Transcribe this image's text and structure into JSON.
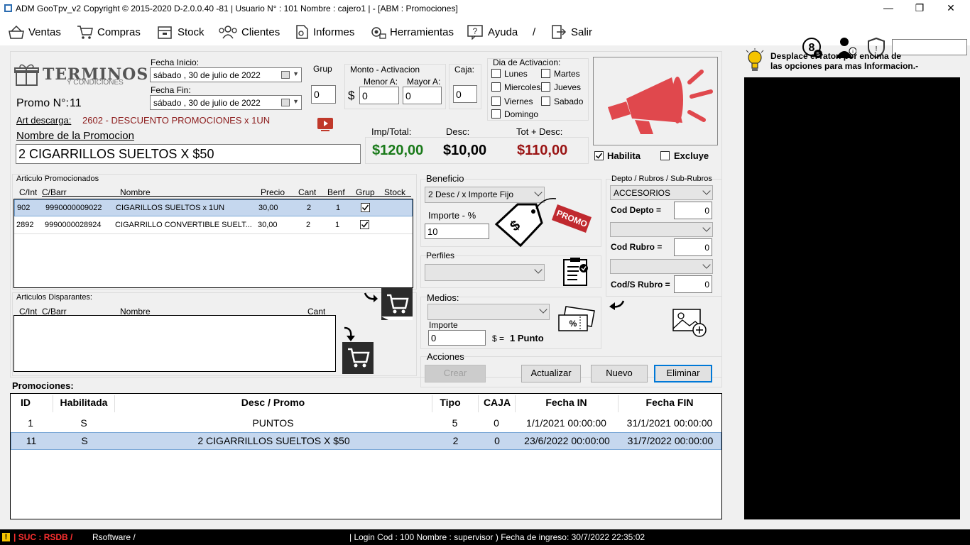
{
  "window": {
    "title": "ADM GooTpv_v2 Copyright ©  2015-2020 D-2.0.0.40 -81 | Usuario N° : 101 Nombre : cajero1 | - [ABM : Promociones]",
    "minimize": "—",
    "maximize": "❐",
    "close": "✕"
  },
  "menu": {
    "ventas": "Ventas",
    "compras": "Compras",
    "stock": "Stock",
    "clientes": "Clientes",
    "informes": "Informes",
    "herramientas": "Herramientas",
    "ayuda": "Ayuda",
    "separator": "/",
    "salir": "Salir"
  },
  "header_icons": [
    "numeric-badge-icon",
    "user-info-icon",
    "shield-icon"
  ],
  "logo": {
    "line1": "TERMINOS",
    "line2": "Y CONDICIONES"
  },
  "promo": {
    "number_label": "Promo N°:",
    "number": "11",
    "fecha_inicio_label": "Fecha Inicio:",
    "fecha_inicio": "sábado  , 30 de      julio      de 2022",
    "fecha_fin_label": "Fecha Fin:",
    "fecha_fin": "sábado  , 30 de      julio      de 2022",
    "grup_label": "Grup",
    "grup": "0",
    "monto_label": "Monto - Activacion",
    "menor_label": "Menor A:",
    "mayor_label": "Mayor A:",
    "currency": "$",
    "menor": "0",
    "mayor": "0",
    "caja_label": "Caja:",
    "caja": "0",
    "art_descarga_label": "Art descarga:",
    "art_descarga": "2602 - DESCUENTO PROMOCIONES  x 1UN",
    "nombre_label": "Nombre de la Promocion",
    "nombre": "2 CIGARRILLOS SUELTOS X $50"
  },
  "dias": {
    "label": "Dia de Activacion:",
    "lunes": "Lunes",
    "martes": "Martes",
    "miercoles": "Miercoles",
    "jueves": "Jueves",
    "viernes": "Viernes",
    "sabado": "Sabado",
    "domingo": "Domingo"
  },
  "totals": {
    "imp_label": "Imp/Total:",
    "desc_label": "Desc:",
    "tot_label": "Tot + Desc:",
    "imp": "$120,00",
    "desc": "$10,00",
    "tot": "$110,00",
    "colors": {
      "imp": "#1a7a1a",
      "desc": "#000000",
      "tot": "#9a1414"
    }
  },
  "flags": {
    "habilita_label": "Habilita",
    "habilita": true,
    "excluye_label": "Excluye",
    "excluye": false
  },
  "promocionados": {
    "label": "Articulo Promocionados",
    "columns": [
      "C/Int",
      "C/Barr",
      "Nombre",
      "Precio",
      "Cant",
      "Benf",
      "Grup",
      "Stock"
    ],
    "rows": [
      {
        "cint": "902",
        "cbarr": "9990000009022",
        "nombre": "CIGARILLOS SUELTOS  x 1UN",
        "precio": "30,00",
        "cant": "2",
        "benf": "1",
        "grup": true
      },
      {
        "cint": "2892",
        "cbarr": "9990000028924",
        "nombre": "CIGARRILLO CONVERTIBLE SUELT...",
        "precio": "30,00",
        "cant": "2",
        "benf": "1",
        "grup": true
      }
    ]
  },
  "disparantes": {
    "label": "Articulos Disparantes:",
    "columns": [
      "C/Int",
      "C/Barr",
      "Nombre",
      "Cant"
    ]
  },
  "beneficio": {
    "label": "Beneficio",
    "tipo": "2 Desc / x Importe Fijo",
    "importe_label": "Importe - %",
    "importe": "10"
  },
  "perfiles": {
    "label": "Perfiles",
    "value": ""
  },
  "medios": {
    "label": "Medios:",
    "value": "",
    "importe_label": "Importe",
    "importe": "0",
    "equals": "$ =",
    "punto": "1 Punto"
  },
  "depto": {
    "label": "Depto / Rubros / Sub-Rubros",
    "depto_value": "ACCESORIOS",
    "cod_depto_label": "Cod Depto =",
    "cod_depto": "0",
    "rubro_value": "",
    "cod_rubro_label": "Cod Rubro =",
    "cod_rubro": "0",
    "srubro_value": "",
    "cod_srubro_label": "Cod/S Rubro =",
    "cod_srubro": "0"
  },
  "acciones": {
    "label": "Acciones",
    "crear": "Crear",
    "actualizar": "Actualizar",
    "nuevo": "Nuevo",
    "eliminar": "Eliminar"
  },
  "promociones": {
    "label": "Promociones:",
    "columns": [
      "ID",
      "Habilitada",
      "Desc / Promo",
      "Tipo",
      "CAJA",
      "Fecha IN",
      "Fecha FIN"
    ],
    "rows": [
      {
        "id": "1",
        "hab": "S",
        "desc": "PUNTOS",
        "tipo": "5",
        "caja": "0",
        "fin": "1/1/2021 00:00:00",
        "ffin": "31/1/2021 00:00:00"
      },
      {
        "id": "11",
        "hab": "S",
        "desc": "2 CIGARRILLOS SUELTOS X $50",
        "tipo": "2",
        "caja": "0",
        "fin": "23/6/2022 00:00:00",
        "ffin": "31/7/2022 00:00:00"
      }
    ]
  },
  "help": {
    "line1": "Desplace el raton por encima de",
    "line2": "las opciones para mas Informacion.-"
  },
  "status": {
    "warn": "!",
    "suc": "| SUC : RSDB /",
    "company": "Rsoftware /",
    "login": "| Login Cod : 100 Nombre : supervisor ) Fecha de ingreso: 30/7/2022 22:35:02"
  }
}
